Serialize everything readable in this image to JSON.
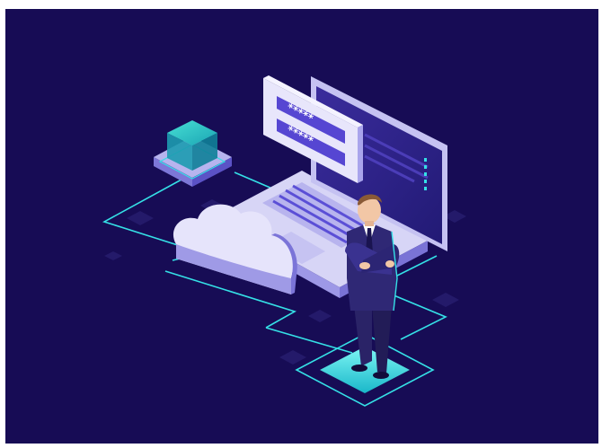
{
  "image": {
    "subject": "isometric-secure-login-illustration",
    "password_fields": [
      {
        "masked_value": "*****"
      },
      {
        "masked_value": "*****"
      }
    ],
    "colors": {
      "background": "#170c55",
      "accent_cyan": "#35e0e6",
      "accent_purple": "#5b4fd6",
      "laptop_light": "#d7d5f6",
      "laptop_screen": "#2b2087",
      "cloud": "#e6e4fb",
      "suit": "#2a2367",
      "skin": "#f2c7a6"
    }
  }
}
